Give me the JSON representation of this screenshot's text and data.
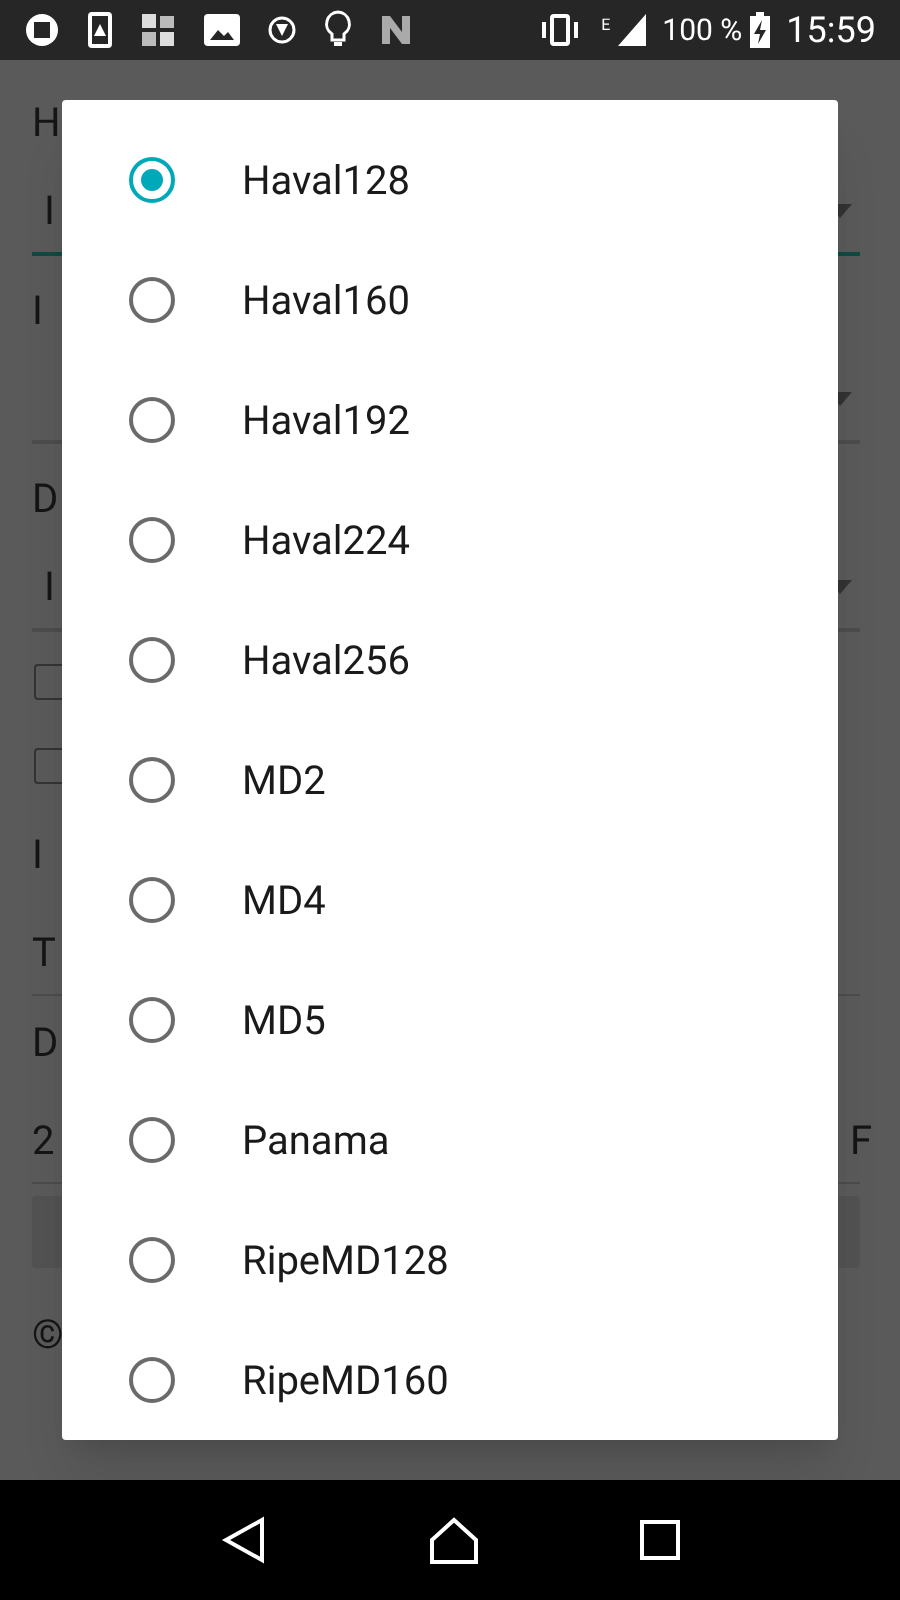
{
  "status_bar": {
    "network": "E",
    "battery": "100 %",
    "time": "15:59"
  },
  "background_form": [
    {
      "kind": "label",
      "text": "H"
    },
    {
      "kind": "dropdown",
      "text": "I",
      "focused": true
    },
    {
      "kind": "label",
      "text": "I"
    },
    {
      "kind": "dropdown",
      "focused": false
    },
    {
      "kind": "label",
      "text": "D"
    },
    {
      "kind": "dropdown",
      "text": "I",
      "focused": false
    },
    {
      "kind": "checkbox",
      "checked": false
    },
    {
      "kind": "checkbox",
      "checked": false
    },
    {
      "kind": "label",
      "text": "I"
    },
    {
      "kind": "field",
      "text": "T"
    },
    {
      "kind": "label",
      "text": "D"
    },
    {
      "kind": "field",
      "text": "2",
      "right_text": "F"
    },
    {
      "kind": "button"
    },
    {
      "kind": "footer",
      "text": "©"
    }
  ],
  "dialog": {
    "options": [
      {
        "label": "Haval128",
        "selected": true
      },
      {
        "label": "Haval160",
        "selected": false
      },
      {
        "label": "Haval192",
        "selected": false
      },
      {
        "label": "Haval224",
        "selected": false
      },
      {
        "label": "Haval256",
        "selected": false
      },
      {
        "label": "MD2",
        "selected": false
      },
      {
        "label": "MD4",
        "selected": false
      },
      {
        "label": "MD5",
        "selected": false
      },
      {
        "label": "Panama",
        "selected": false
      },
      {
        "label": "RipeMD128",
        "selected": false
      },
      {
        "label": "RipeMD160",
        "selected": false
      }
    ]
  }
}
